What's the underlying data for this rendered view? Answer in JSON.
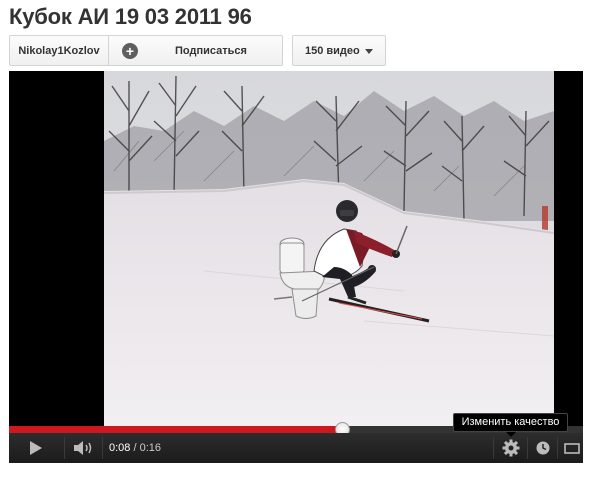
{
  "video": {
    "title": "Кубок АИ 19 03 2011 96"
  },
  "channel": {
    "name": "Nikolay1Kozlov",
    "subscribe_label": "Подписаться",
    "videos_label": "150 видео"
  },
  "player": {
    "progress_fraction": 0.58,
    "current_time": "0:08",
    "time_separator": " / ",
    "duration": "0:16",
    "quality_tooltip": "Изменить качество",
    "colors": {
      "progress": "#cc181e",
      "controls_bg": "#1b1b1b",
      "letterbox": "#000000"
    },
    "icons": [
      "play-icon",
      "volume-icon",
      "settings-gear-icon",
      "watch-later-clock-icon",
      "widescreen-icon"
    ]
  }
}
